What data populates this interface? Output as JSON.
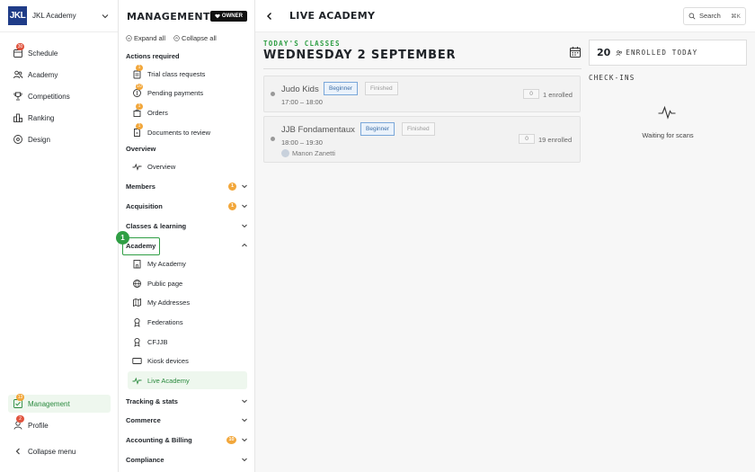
{
  "brand": {
    "logo_text": "JKL",
    "name": "JKL Academy"
  },
  "sidebar": {
    "items": [
      {
        "label": "Schedule",
        "icon": "calendar-icon",
        "badge": "30"
      },
      {
        "label": "Academy",
        "icon": "users-icon"
      },
      {
        "label": "Competitions",
        "icon": "trophy-icon"
      },
      {
        "label": "Ranking",
        "icon": "bar-chart-icon"
      },
      {
        "label": "Design",
        "icon": "palette-icon"
      }
    ],
    "bottom": [
      {
        "label": "Management",
        "icon": "checklist-icon",
        "badge": "13",
        "active": true
      },
      {
        "label": "Profile",
        "icon": "user-icon",
        "badge": "2"
      }
    ],
    "collapse_label": "Collapse menu"
  },
  "subnav": {
    "title": "MANAGEMENT",
    "owner_label": "OWNER",
    "expand_all": "Expand all",
    "collapse_all": "Collapse all",
    "actions_required_label": "Actions required",
    "actions": [
      {
        "label": "Trial class requests",
        "badge": "1"
      },
      {
        "label": "Pending payments",
        "badge": "10"
      },
      {
        "label": "Orders",
        "badge": "1"
      },
      {
        "label": "Documents to review",
        "badge": "1"
      }
    ],
    "overview_label": "Overview",
    "overview_item": "Overview",
    "groups": [
      {
        "label": "Members",
        "count": "1"
      },
      {
        "label": "Acquisition",
        "count": "1"
      },
      {
        "label": "Classes & learning"
      },
      {
        "label": "Academy"
      }
    ],
    "academy_items": [
      {
        "label": "My Academy",
        "icon": "building-icon"
      },
      {
        "label": "Public page",
        "icon": "globe-icon"
      },
      {
        "label": "My Addresses",
        "icon": "map-icon"
      },
      {
        "label": "Federations",
        "icon": "award-icon"
      },
      {
        "label": "CFJJB",
        "icon": "award-icon"
      },
      {
        "label": "Kiosk devices",
        "icon": "monitor-icon"
      },
      {
        "label": "Live Academy",
        "icon": "pulse-icon",
        "active": true
      }
    ],
    "groups_after": [
      {
        "label": "Tracking & stats"
      },
      {
        "label": "Commerce"
      },
      {
        "label": "Accounting & Billing",
        "count": "10"
      },
      {
        "label": "Compliance"
      }
    ],
    "step_marker": "1"
  },
  "main": {
    "title": "LIVE ACADEMY",
    "search_label": "Search",
    "search_shortcut": "⌘K",
    "today_label": "TODAY'S CLASSES",
    "date_label": "WEDNESDAY 2 SEPTEMBER",
    "classes": [
      {
        "name": "Judo Kids",
        "level": "Beginner",
        "status": "Finished",
        "time": "17:00 – 18:00",
        "count": "0",
        "enrolled": "1 enrolled"
      },
      {
        "name": "JJB Fondamentaux",
        "level": "Beginner",
        "status": "Finished",
        "time": "18:00 – 19:30",
        "count": "0",
        "enrolled": "19 enrolled",
        "coach": "Manon Zanetti"
      }
    ],
    "enrolled_today_count": "20",
    "enrolled_today_label": "ENROLLED TODAY",
    "checkins_label": "CHECK-INS",
    "waiting_label": "Waiting for scans"
  }
}
